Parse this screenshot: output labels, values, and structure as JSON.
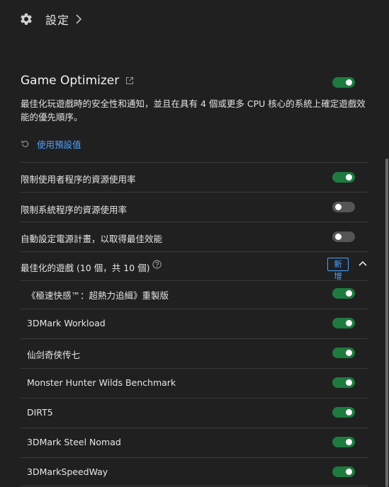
{
  "breadcrumb": {
    "label": "設定"
  },
  "section": {
    "title": "Game Optimizer",
    "enabled": true,
    "description": "最佳化玩遊戲時的安全性和通知，並且在具有 4 個或更多 CPU 核心的系統上確定遊戲效能的優先順序。"
  },
  "reset_label": "使用預設值",
  "settings": [
    {
      "label": "限制使用者程序的資源使用率",
      "enabled": true
    },
    {
      "label": "限制系統程序的資源使用率",
      "enabled": false
    },
    {
      "label": "自動設定電源計畫，以取得最佳效能",
      "enabled": false
    }
  ],
  "games_header": {
    "label": "最佳化的遊戲 (10 個，共 10 個)",
    "add_label": "新增",
    "expanded": true
  },
  "games": [
    {
      "name": "《極速快感™：超熱力追緝》重製版",
      "enabled": true
    },
    {
      "name": "3DMark Workload",
      "enabled": true
    },
    {
      "name": "仙剑奇侠传七",
      "enabled": true
    },
    {
      "name": "Monster Hunter Wilds Benchmark",
      "enabled": true
    },
    {
      "name": "DIRT5",
      "enabled": true
    },
    {
      "name": "3DMark Steel Nomad",
      "enabled": true
    },
    {
      "name": "3DMarkSpeedWay",
      "enabled": true
    }
  ],
  "colors": {
    "background": "#202020",
    "accent_link": "#4ea2ff",
    "toggle_on": "#1e7a3f",
    "toggle_off": "#555555",
    "divider": "#3a3a3a"
  }
}
